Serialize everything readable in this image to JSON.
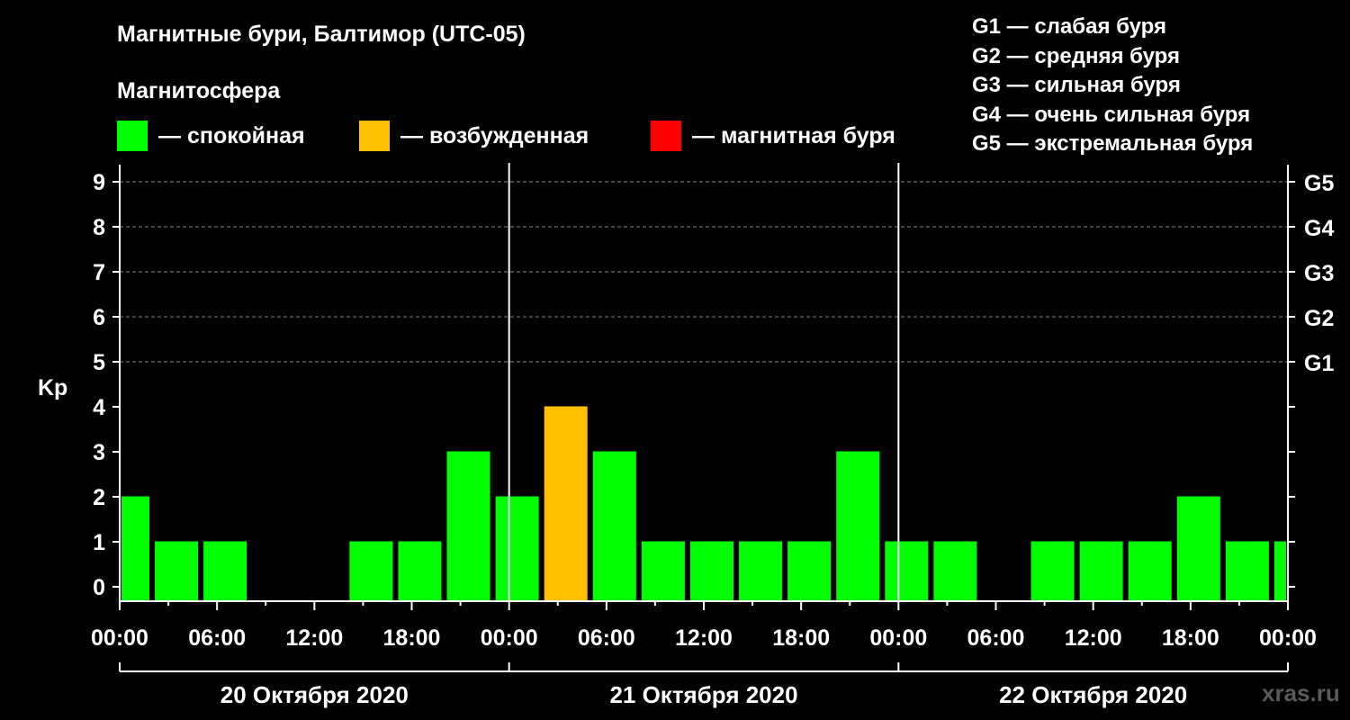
{
  "title": "Магнитные бури, Балтимор (UTC-05)",
  "magnetosphere_label": "Магнитосфера",
  "legend": [
    {
      "label": "— спокойная",
      "color": "#00ff00"
    },
    {
      "label": "— возбужденная",
      "color": "#ffc000"
    },
    {
      "label": "— магнитная буря",
      "color": "#ff0000"
    }
  ],
  "storm_scale": [
    "G1 — слабая буря",
    "G2 — средняя буря",
    "G3 — сильная буря",
    "G4 — очень сильная буря",
    "G5 — экстремальная буря"
  ],
  "watermark": "xras.ru",
  "chart_data": {
    "type": "bar",
    "ylabel": "Kp",
    "ylim": [
      0,
      9
    ],
    "y_ticks": [
      "0",
      "1",
      "2",
      "3",
      "4",
      "5",
      "6",
      "7",
      "8",
      "9"
    ],
    "right_ticks": [
      {
        "value": 5,
        "label": "G1"
      },
      {
        "value": 6,
        "label": "G2"
      },
      {
        "value": 7,
        "label": "G3"
      },
      {
        "value": 8,
        "label": "G4"
      },
      {
        "value": 9,
        "label": "G5"
      }
    ],
    "grid_dashed_levels": [
      5,
      6,
      7,
      8,
      9
    ],
    "x_tick_labels": [
      "00:00",
      "06:00",
      "12:00",
      "18:00",
      "00:00",
      "06:00",
      "12:00",
      "18:00",
      "00:00",
      "06:00",
      "12:00",
      "18:00",
      "00:00"
    ],
    "day_labels": [
      "20 Октября 2020",
      "21 Октября 2020",
      "22 Октября 2020"
    ],
    "interval_hours": 3,
    "start_hour": -1,
    "values": [
      2,
      1,
      1,
      0,
      0,
      1,
      1,
      3,
      2,
      4,
      3,
      1,
      1,
      1,
      1,
      3,
      1,
      1,
      0,
      1,
      1,
      1,
      2,
      1,
      1
    ],
    "colors": {
      "quiet": "#00ff00",
      "active": "#ffc000",
      "storm": "#ff0000"
    }
  }
}
